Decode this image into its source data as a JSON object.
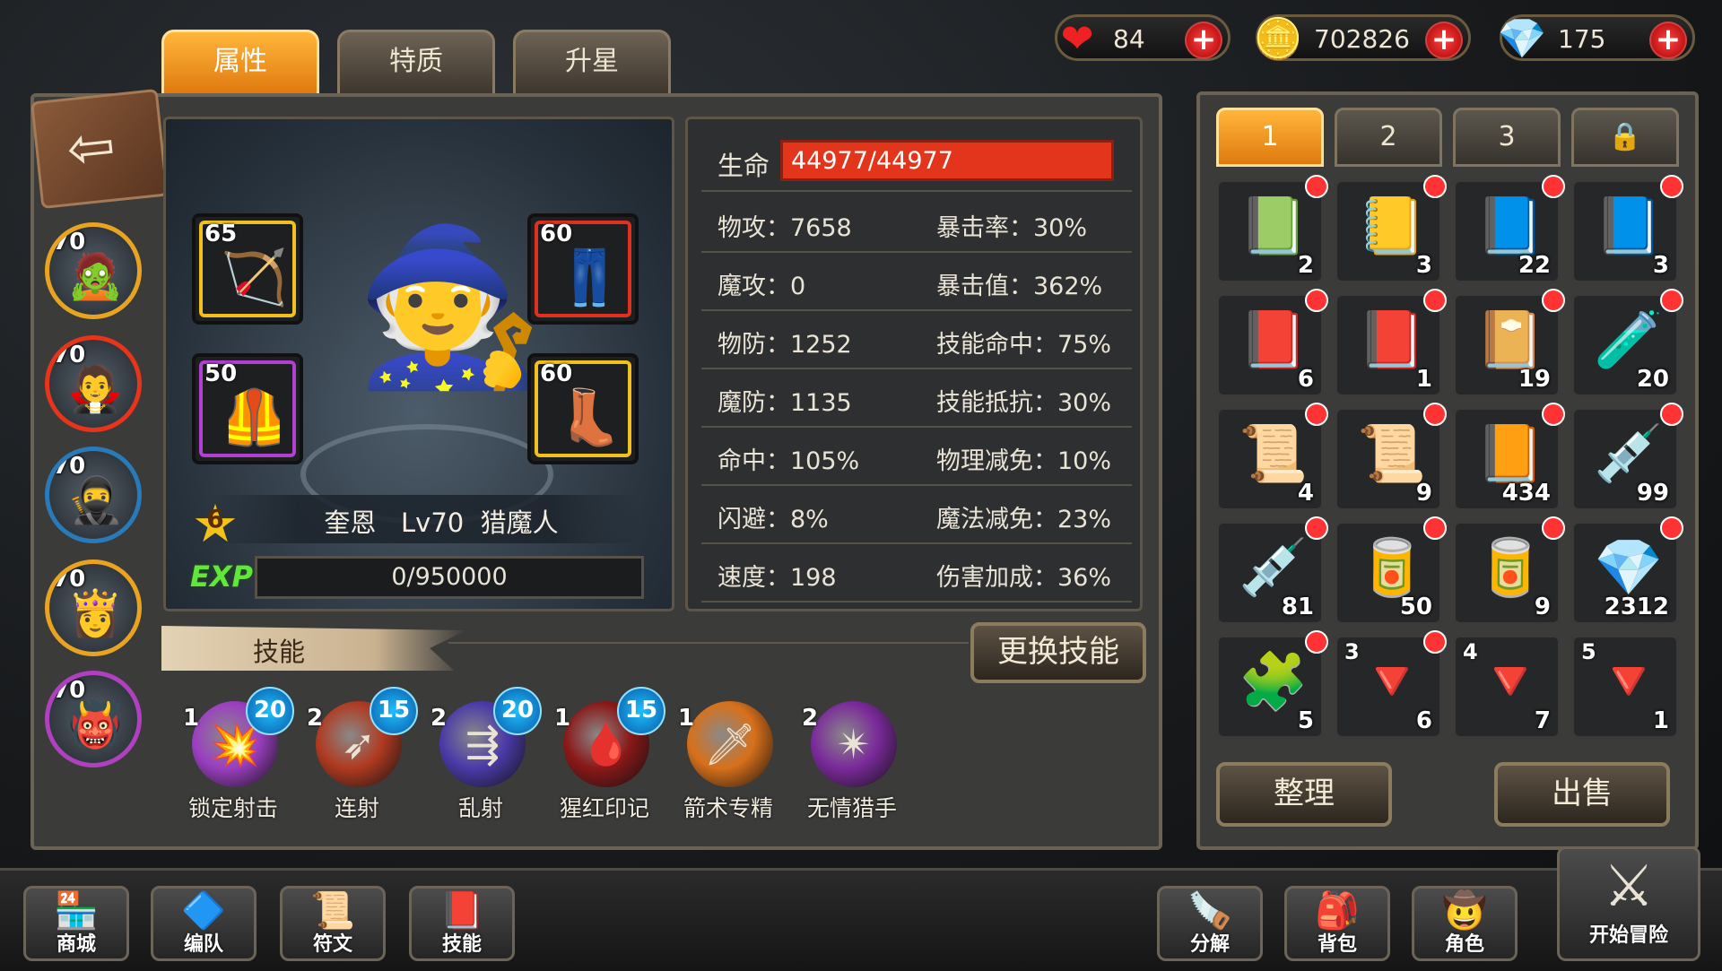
{
  "currency": {
    "hearts": {
      "icon": "heart-icon",
      "value": "84"
    },
    "gold": {
      "icon": "gold-coins-icon",
      "value": "702826"
    },
    "gems": {
      "icon": "crystal-icon",
      "value": "175"
    },
    "plus": "+"
  },
  "tabs": [
    "属性",
    "特质",
    "升星"
  ],
  "heroes": [
    {
      "level": "70",
      "face": "🧟"
    },
    {
      "level": "70",
      "face": "🧛"
    },
    {
      "level": "70",
      "face": "🥷"
    },
    {
      "level": "70",
      "face": "👸"
    },
    {
      "level": "70",
      "face": "👹"
    }
  ],
  "character": {
    "stars": "6",
    "name_line": "奎恩   Lv70  猎魔人",
    "exp_label": "EXP",
    "exp": "0/950000",
    "figure": "🧙"
  },
  "equipment": [
    {
      "level": "65",
      "art": "🏹",
      "color": "#f0c020"
    },
    {
      "level": "60",
      "art": "👖",
      "color": "#e03020"
    },
    {
      "level": "50",
      "art": "🦺",
      "color": "#b040d0"
    },
    {
      "level": "60",
      "art": "👢",
      "color": "#f0c020"
    }
  ],
  "stats": {
    "hp_label": "生命",
    "hp_value": "44977/44977",
    "rows": [
      [
        "物攻：7658",
        "暴击率：30%"
      ],
      [
        "魔攻：0",
        "暴击值：362%"
      ],
      [
        "物防：1252",
        "技能命中：75%"
      ],
      [
        "魔防：1135",
        "技能抵抗：30%"
      ],
      [
        "命中：105%",
        "物理减免：10%"
      ],
      [
        "闪避：8%",
        "魔法减免：23%"
      ],
      [
        "速度：198",
        "伤害加成：36%"
      ]
    ]
  },
  "skills_section": {
    "title": "技能",
    "change_button": "更换技能",
    "skills": [
      {
        "level": "1",
        "cost": "20",
        "name": "锁定射击",
        "icon": "💥",
        "color": "#9b3fc0"
      },
      {
        "level": "2",
        "cost": "15",
        "name": "连射",
        "icon": "➶",
        "color": "#b03a20"
      },
      {
        "level": "2",
        "cost": "20",
        "name": "乱射",
        "icon": "⇶",
        "color": "#4a3aa8"
      },
      {
        "level": "1",
        "cost": "15",
        "name": "猩红印记",
        "icon": "🩸",
        "color": "#8a1818"
      },
      {
        "level": "1",
        "cost": "",
        "name": "箭术专精",
        "icon": "🗡",
        "color": "#d8701a"
      },
      {
        "level": "2",
        "cost": "",
        "name": "无情猎手",
        "icon": "✴",
        "color": "#7a2a9a"
      }
    ]
  },
  "inventory": {
    "tabs": [
      "1",
      "2",
      "3",
      "lock"
    ],
    "items": [
      {
        "art": "📗",
        "count": "2",
        "level": ""
      },
      {
        "art": "📒",
        "count": "3",
        "level": ""
      },
      {
        "art": "📘",
        "count": "22",
        "level": ""
      },
      {
        "art": "📘",
        "count": "3",
        "level": ""
      },
      {
        "art": "📕",
        "count": "6",
        "level": ""
      },
      {
        "art": "📕",
        "count": "1",
        "level": ""
      },
      {
        "art": "📔",
        "count": "19",
        "level": ""
      },
      {
        "art": "🧪",
        "count": "20",
        "level": ""
      },
      {
        "art": "📜",
        "count": "4",
        "level": ""
      },
      {
        "art": "📜",
        "count": "9",
        "level": ""
      },
      {
        "art": "📙",
        "count": "434",
        "level": ""
      },
      {
        "art": "💉",
        "count": "99",
        "level": ""
      },
      {
        "art": "💉",
        "count": "81",
        "level": ""
      },
      {
        "art": "🥫",
        "count": "50",
        "level": ""
      },
      {
        "art": "🥫",
        "count": "9",
        "level": ""
      },
      {
        "art": "💎",
        "count": "2312",
        "level": ""
      },
      {
        "art": "🧩",
        "count": "5",
        "level": ""
      },
      {
        "art": "🔻",
        "count": "6",
        "level": "3"
      },
      {
        "art": "🔻",
        "count": "7",
        "level": "4"
      },
      {
        "art": "🔻",
        "count": "1",
        "level": "5"
      }
    ],
    "sort_button": "整理",
    "sell_button": "出售"
  },
  "bottom_nav": [
    {
      "label": "商城",
      "icon": "🏪"
    },
    {
      "label": "编队",
      "icon": "🔷"
    },
    {
      "label": "符文",
      "icon": "📜"
    },
    {
      "label": "技能",
      "icon": "📕"
    },
    {
      "label": "分解",
      "icon": "🪚"
    },
    {
      "label": "背包",
      "icon": "🎒"
    },
    {
      "label": "角色",
      "icon": "🤠"
    },
    {
      "label": "开始冒险",
      "icon": "⚔"
    }
  ]
}
